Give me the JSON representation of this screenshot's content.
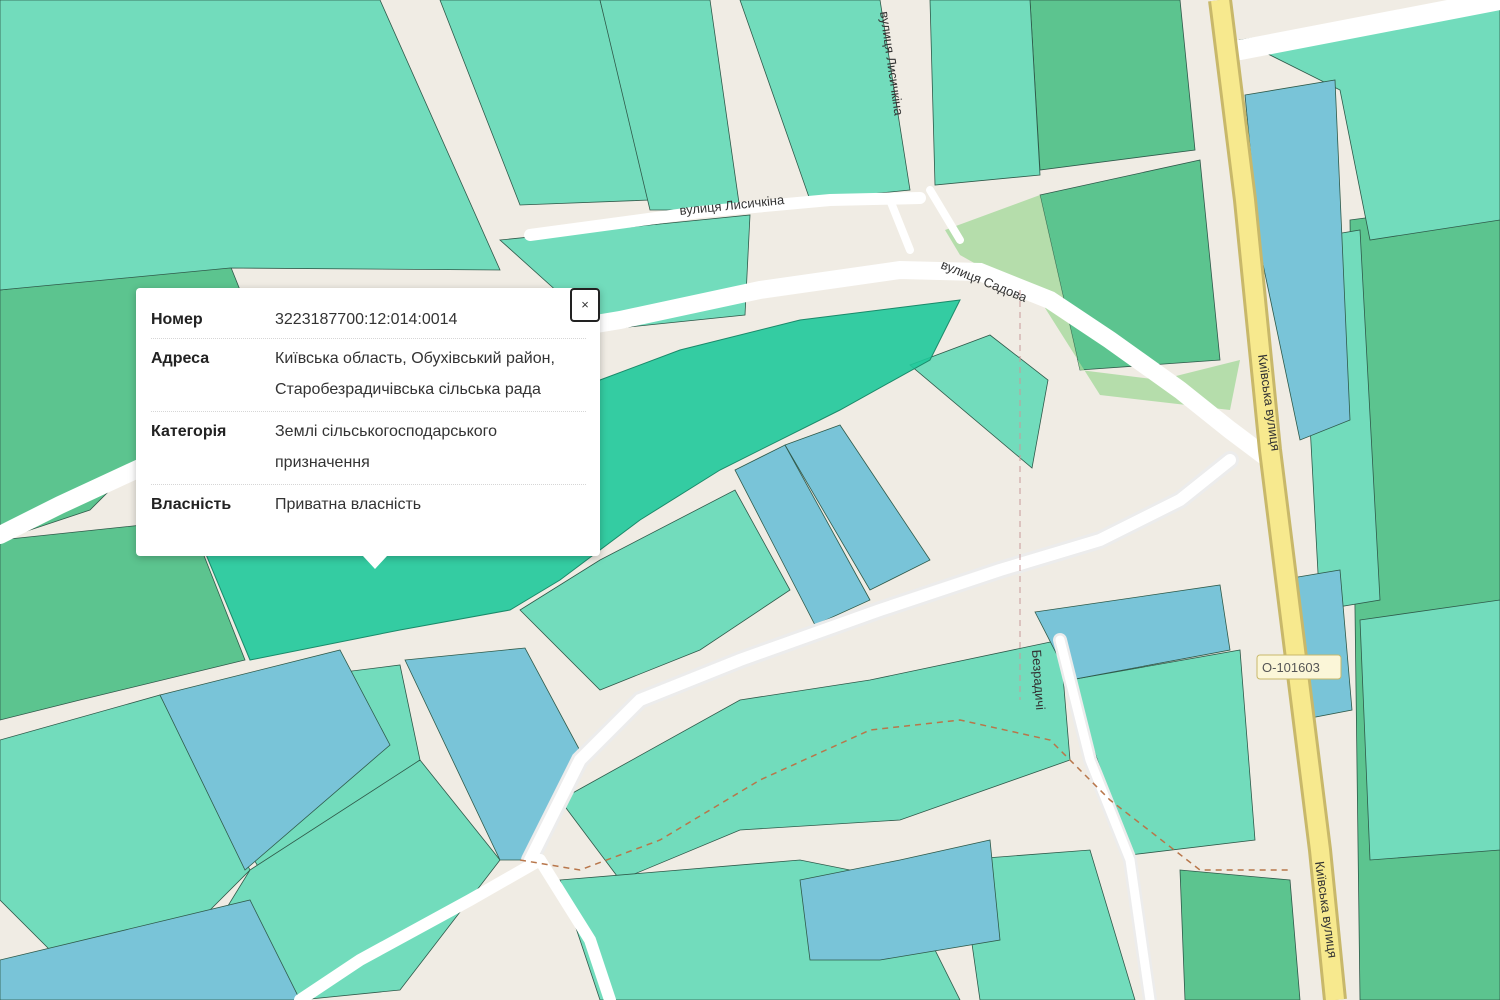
{
  "map": {
    "streets": [
      {
        "name": "street-lysychkina-1",
        "label": "вулиця Лисичкіна"
      },
      {
        "name": "street-lysychkina-2",
        "label": "вулиця Лисичкіна"
      },
      {
        "name": "street-sadova",
        "label": "вулиця Садова"
      },
      {
        "name": "street-kyivska-1",
        "label": "Київська вулиця"
      },
      {
        "name": "street-kyivska-2",
        "label": "Київська вулиця"
      },
      {
        "name": "street-bezradychi",
        "label": "Безрадичі"
      }
    ],
    "road_ref": "О-101603",
    "colors": {
      "agricultural": "#6fdcb8",
      "selected": "#1fc99a",
      "blue_parcel": "#76c3d9",
      "forest": "#5cc48f",
      "base": "#f0ece4"
    }
  },
  "popup": {
    "close_label": "×",
    "rows": [
      {
        "key": "Номер",
        "value": "3223187700:12:014:0014"
      },
      {
        "key": "Адреса",
        "value": "Київська область, Обухівський район, Старобезрадичівська сільська рада"
      },
      {
        "key": "Категорія",
        "value": "Землі сільськогосподарського призначення"
      },
      {
        "key": "Власність",
        "value": "Приватна власність"
      }
    ]
  }
}
